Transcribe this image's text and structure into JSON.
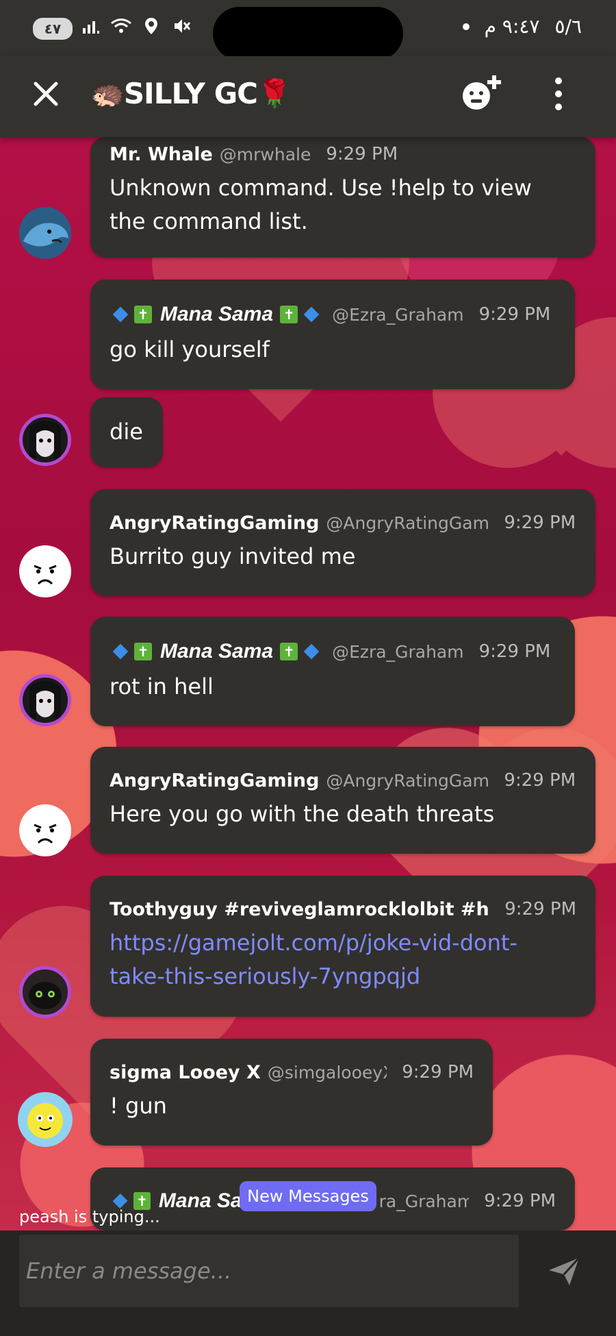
{
  "status_bar": {
    "battery": "٤٧",
    "signal_icon": "signal-bars-icon",
    "wifi_icon": "wifi-icon",
    "location_icon": "location-icon",
    "mute_icon": "mute-icon",
    "time": "٩:٤٧ م",
    "date": "٥/٦"
  },
  "header": {
    "close_icon": "close-icon",
    "title_emoji_left": "🦔",
    "title": "SILLY GC",
    "title_emoji_right": "🌹",
    "add_friend_icon": "add-friend-icon",
    "more_icon": "more-vertical-icon"
  },
  "messages": [
    {
      "name": "Mr. Whale",
      "handle": "@mrwhale",
      "time": "9:29 PM",
      "lines": [
        "Unknown command. Use !help to view",
        "the command list."
      ]
    },
    {
      "name": "Mana Sama",
      "handle": "@Ezra_Graham",
      "time": "9:29 PM",
      "lines": [
        "go kill yourself"
      ]
    },
    {
      "lines": [
        "die"
      ]
    },
    {
      "name": "AngryRatingGaming",
      "handle": "@AngryRatingGami",
      "time": "9:29 PM",
      "lines": [
        "Burrito guy invited me"
      ]
    },
    {
      "name": "Mana Sama",
      "handle": "@Ezra_Graham",
      "time": "9:29 PM",
      "lines": [
        "rot in hell"
      ]
    },
    {
      "name": "AngryRatingGaming",
      "handle": "@AngryRatingGami",
      "time": "9:29 PM",
      "lines": [
        "Here you go with the death threats"
      ]
    },
    {
      "name": "Toothyguy #reviveglamrocklolbit #help",
      "time": "9:29 PM",
      "lines": [
        "https://gamejolt.com/p/joke-vid-dont-",
        "take-this-seriously-7yngpqjd"
      ]
    },
    {
      "name": "sigma Looey X",
      "handle": "@simgalooeyX",
      "time": "9:29 PM",
      "lines": [
        "! gun"
      ]
    },
    {
      "name": "Mana Sa",
      "handle": "ra_Graham",
      "time": "9:29 PM"
    }
  ],
  "badges": {
    "cross": "✝"
  },
  "new_messages_label": "New Messages",
  "typing_indicator": "peash is typing...",
  "composer": {
    "placeholder": "Enter a message...",
    "send_icon": "send-icon"
  },
  "colors": {
    "bar": "#33322f",
    "bubble": "#32302d",
    "link": "#7f8bff",
    "accent": "#6f6cf3"
  }
}
